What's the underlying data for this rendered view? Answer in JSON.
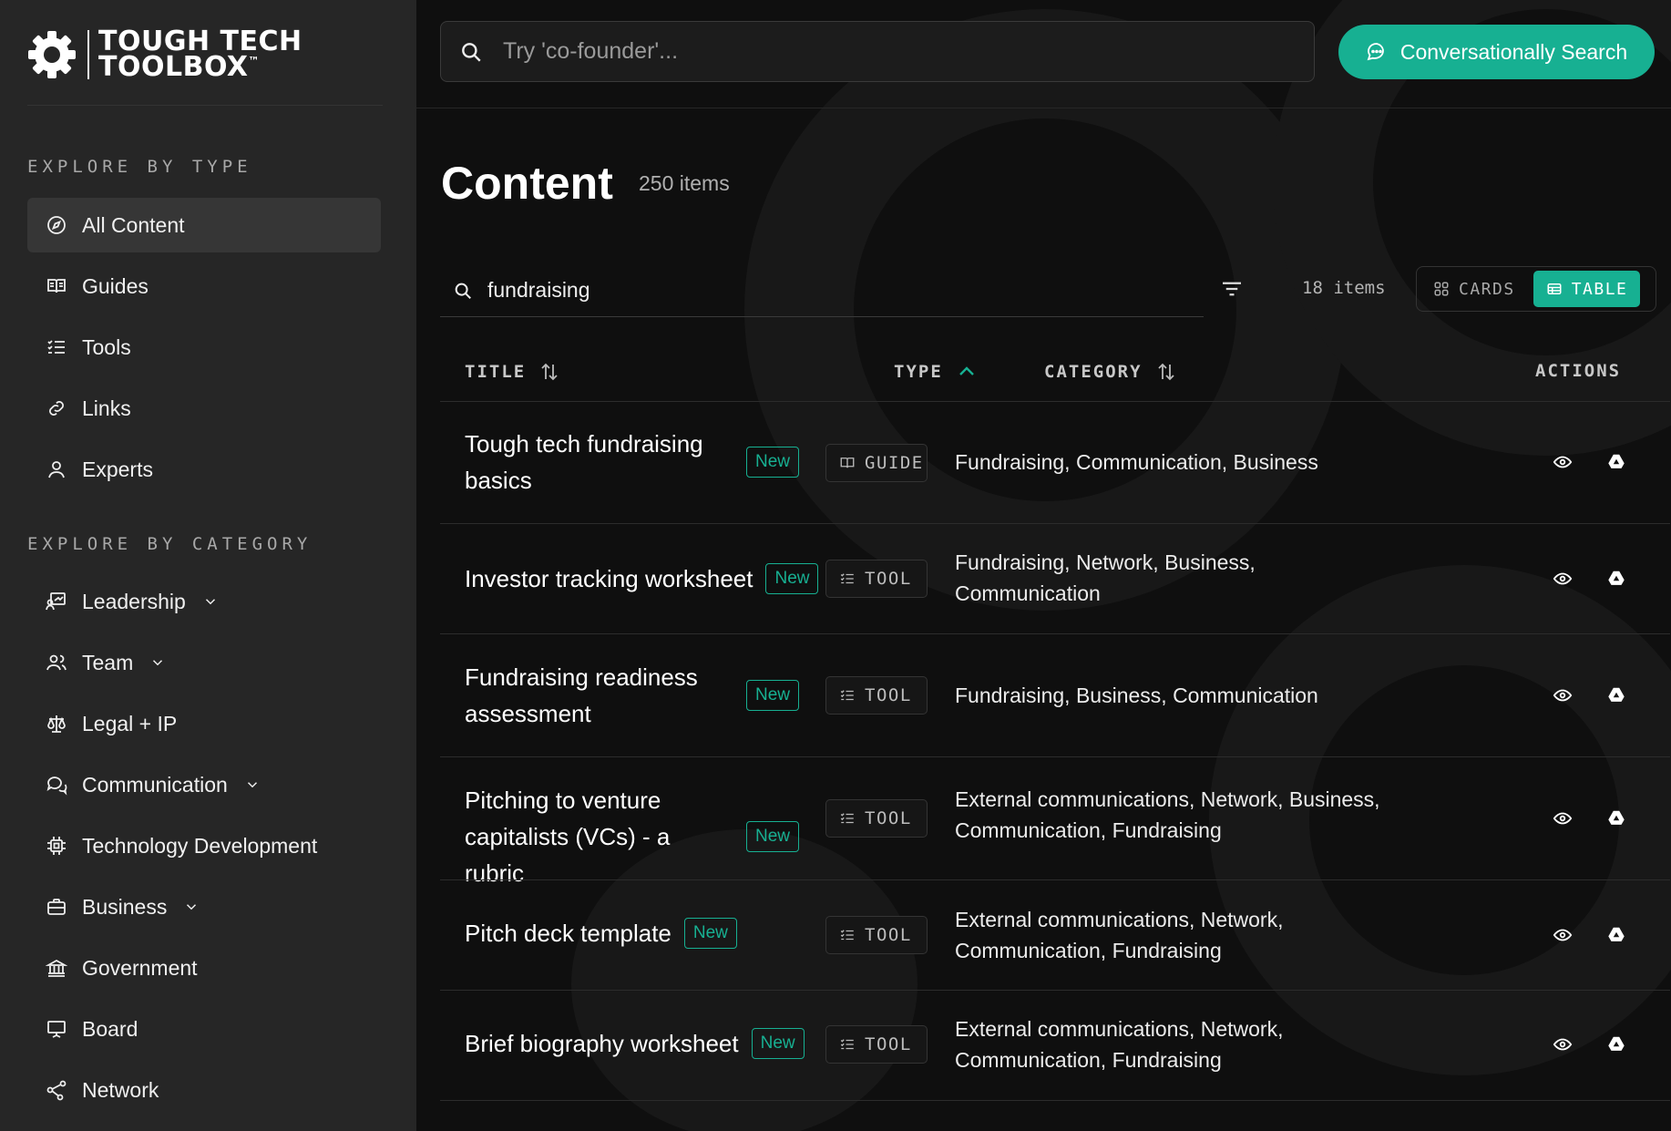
{
  "brand": {
    "line1": "TOUGH TECH",
    "line2": "TOOLBOX",
    "tm": "™"
  },
  "sidebar": {
    "type_heading": "EXPLORE BY TYPE",
    "type_items": [
      {
        "label": "All Content",
        "icon": "compass-icon"
      },
      {
        "label": "Guides",
        "icon": "book-icon"
      },
      {
        "label": "Tools",
        "icon": "checklist-icon"
      },
      {
        "label": "Links",
        "icon": "link-icon"
      },
      {
        "label": "Experts",
        "icon": "user-icon"
      }
    ],
    "category_heading": "EXPLORE BY CATEGORY",
    "category_items": [
      {
        "label": "Leadership",
        "icon": "presentation-icon",
        "expandable": true
      },
      {
        "label": "Team",
        "icon": "users-icon",
        "expandable": true
      },
      {
        "label": "Legal + IP",
        "icon": "scale-icon",
        "expandable": false
      },
      {
        "label": "Communication",
        "icon": "chat-icon",
        "expandable": true
      },
      {
        "label": "Technology Development",
        "icon": "chip-icon",
        "expandable": false
      },
      {
        "label": "Business",
        "icon": "briefcase-icon",
        "expandable": true
      },
      {
        "label": "Government",
        "icon": "building-icon",
        "expandable": false
      },
      {
        "label": "Board",
        "icon": "board-icon",
        "expandable": false
      },
      {
        "label": "Network",
        "icon": "share-icon",
        "expandable": false
      }
    ]
  },
  "header": {
    "search_placeholder": "Try 'co-founder'...",
    "conversational_button": "Conversationally Search"
  },
  "content": {
    "title": "Content",
    "total": "250 items",
    "filter_value": "fundraising",
    "result_count": "18 items",
    "view_cards": "CARDS",
    "view_table": "TABLE",
    "active_view": "TABLE"
  },
  "table": {
    "columns": {
      "title": "TITLE",
      "type": "TYPE",
      "category": "CATEGORY",
      "actions": "ACTIONS"
    },
    "rows": [
      {
        "title": "Tough tech fundraising basics",
        "badge": "New",
        "type": "GUIDE",
        "categories": "Fundraising, Communication, Business"
      },
      {
        "title": "Investor tracking worksheet",
        "badge": "New",
        "type": "TOOL",
        "categories": "Fundraising, Network, Business, Communication"
      },
      {
        "title": "Fundraising readiness assessment",
        "badge": "New",
        "type": "TOOL",
        "categories": "Fundraising, Business, Communication"
      },
      {
        "title": "Pitching to venture capitalists (VCs) - a rubric",
        "badge": "New",
        "type": "TOOL",
        "categories": "External communications, Network, Business, Communication, Fundraising"
      },
      {
        "title": "Pitch deck template",
        "badge": "New",
        "type": "TOOL",
        "categories": "External communications, Network, Communication, Fundraising"
      },
      {
        "title": "Brief biography worksheet",
        "badge": "New",
        "type": "TOOL",
        "categories": "External communications, Network, Communication, Fundraising"
      }
    ]
  },
  "colors": {
    "accent": "#17b092",
    "sidebar_bg": "#262626",
    "main_bg": "#0f0f0f"
  }
}
